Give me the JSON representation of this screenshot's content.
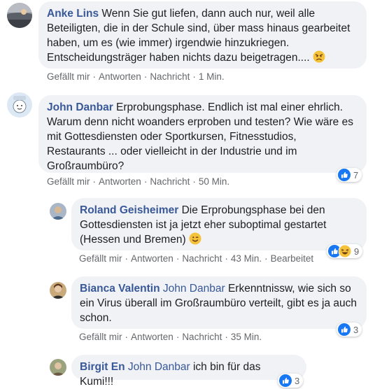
{
  "comments": [
    {
      "author": "Anke Lins",
      "mention": "",
      "text": "Wenn Sie gut liefen, dann auch nur, weil alle Beteiligten, die in der Schule sind, über mass hinaus gearbeitet haben, um es (wie immer) irgendwie hinzukriegen. Entscheidungsträger haben nichts dazu beigetragen....",
      "actions": {
        "like": "Gefällt mir",
        "reply": "Antworten",
        "message": "Nachricht",
        "time": "1 Min."
      }
    },
    {
      "author": "John Danbar",
      "mention": "",
      "text": "Erprobungsphase. Endlich ist mal einer ehrlich. Warum denn nicht woanders erproben und testen? Wie wäre es mit Gottesdiensten oder Sportkursen, Fitnesstudios, Restaurants ... oder vielleicht in der Industrie und im Großraumbüro?",
      "actions": {
        "like": "Gefällt mir",
        "reply": "Antworten",
        "message": "Nachricht",
        "time": "50 Min."
      },
      "reaction_count": "7"
    },
    {
      "author": "Roland Geisheimer",
      "mention": "",
      "text": "Die Erprobungsphase bei den Gottesdiensten ist ja jetzt eher suboptimal gestartet (Hessen und Bremen)",
      "actions": {
        "like": "Gefällt mir",
        "reply": "Antworten",
        "message": "Nachricht",
        "time": "43 Min.",
        "edited": "Bearbeitet"
      },
      "reaction_count": "9"
    },
    {
      "author": "Bianca Valentin",
      "mention": "John Danbar",
      "text": "Erkenntnissw, wie sich so ein Virus überall im Großraumbüro verteilt, gibt es ja auch schon.",
      "actions": {
        "like": "Gefällt mir",
        "reply": "Antworten",
        "message": "Nachricht",
        "time": "35 Min."
      },
      "reaction_count": "3"
    },
    {
      "author": "Birgit En",
      "mention": "John Danbar",
      "text": "ich bin für das Kumi!!!",
      "reaction_count": "3"
    }
  ],
  "colors": {
    "link": "#385898",
    "bubble": "#f0f2f5",
    "meta": "#65676b",
    "like_blue": "#1877f2"
  },
  "icons": [
    "like-icon",
    "haha-icon",
    "angry-emoji-icon",
    "wink-emoji-icon"
  ]
}
